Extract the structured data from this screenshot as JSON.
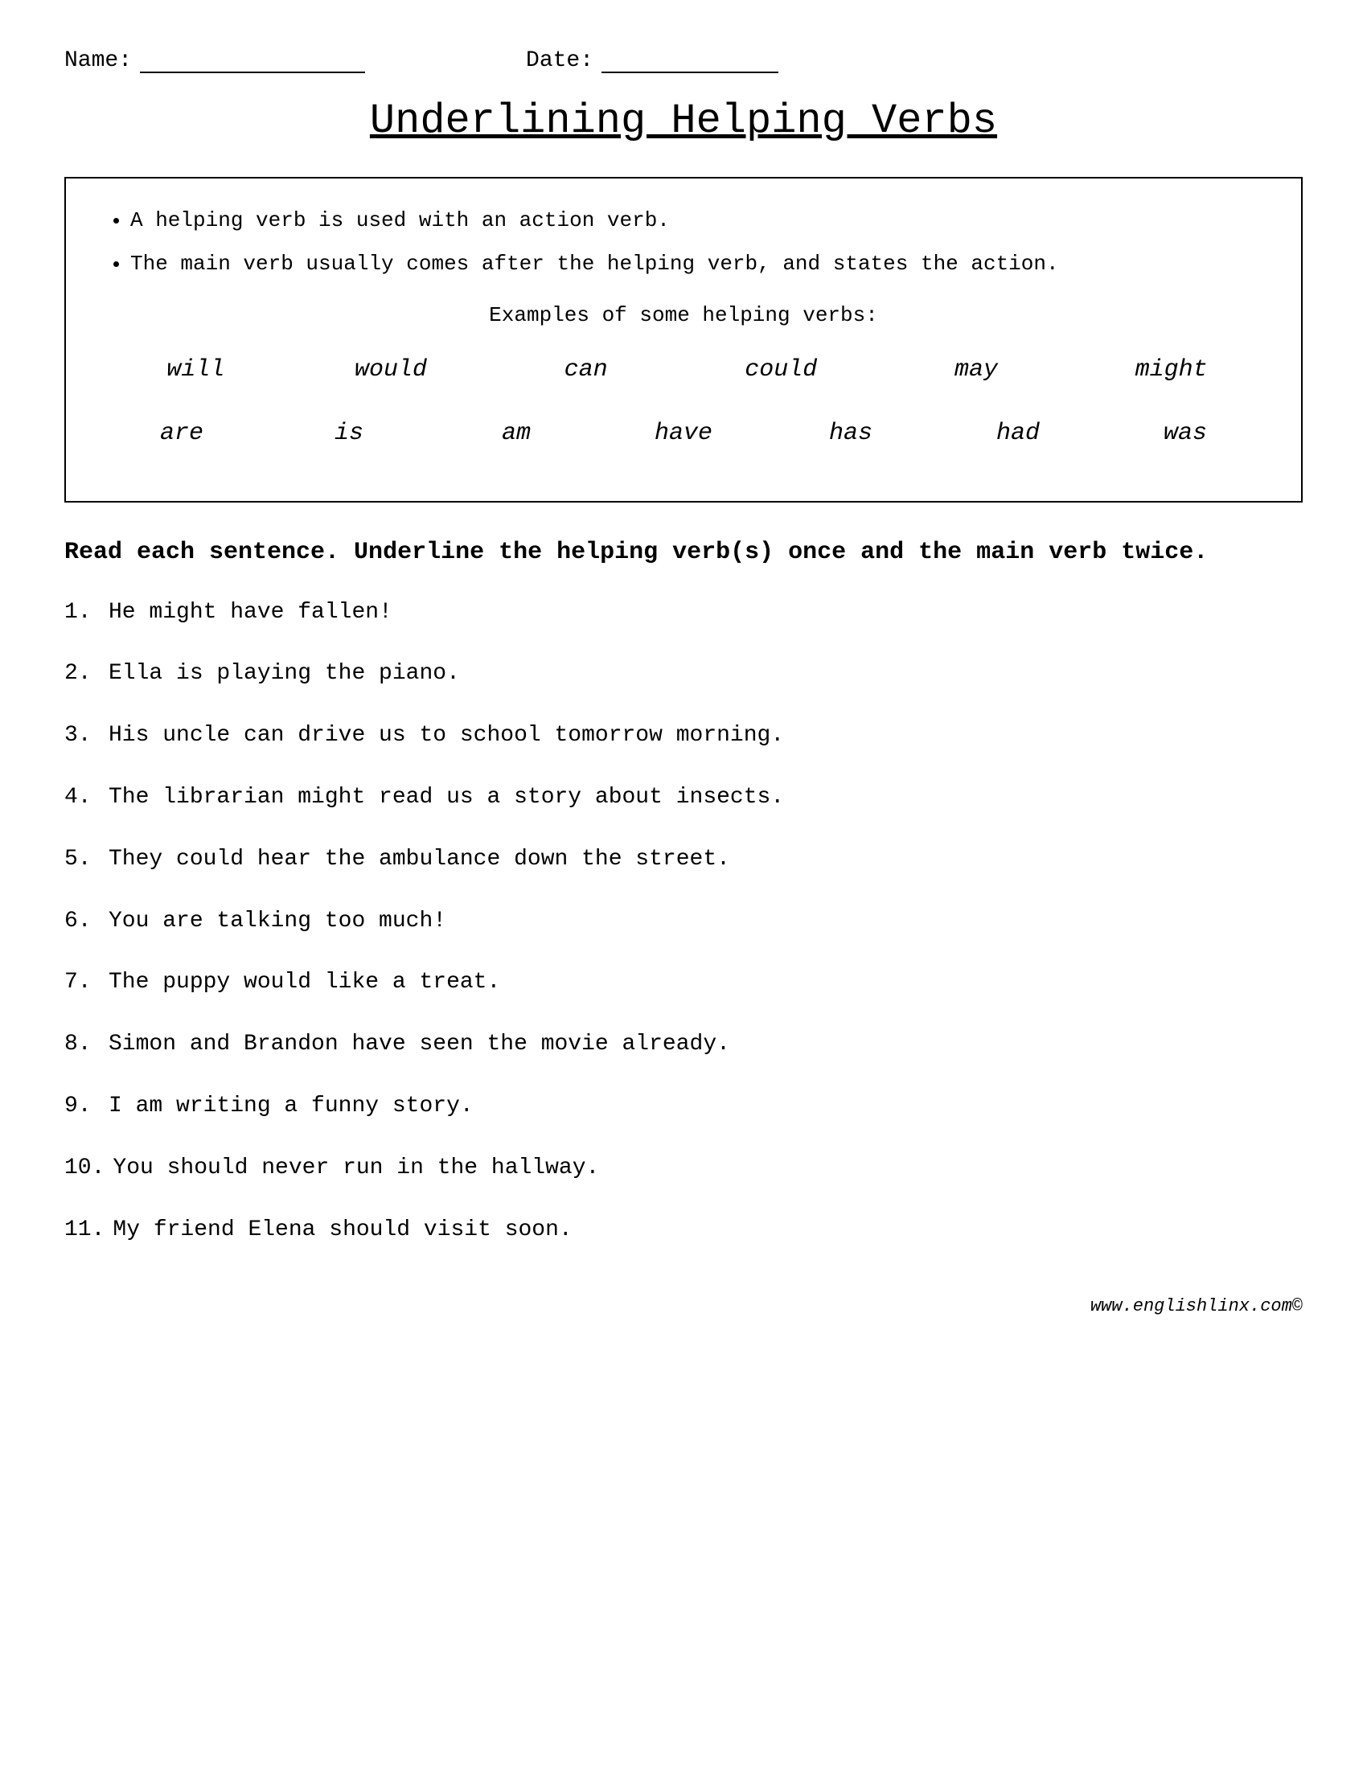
{
  "header": {
    "name_label": "Name:",
    "date_label": "Date:"
  },
  "title": "Underlining Helping Verbs",
  "info_box": {
    "bullets": [
      "A helping verb is used with an action verb.",
      "The main verb usually comes after the helping verb, and states the action."
    ],
    "examples_title": "Examples of some helping verbs:",
    "verb_row1": [
      "will",
      "would",
      "can",
      "could",
      "may",
      "might"
    ],
    "verb_row2": [
      "are",
      "is",
      "am",
      "have",
      "has",
      "had",
      "was"
    ]
  },
  "instructions": "Read each sentence. Underline the helping verb(s) once and the main verb twice.",
  "sentences": [
    {
      "number": "1.",
      "text": "He might have fallen!"
    },
    {
      "number": "2.",
      "text": "Ella is playing the piano."
    },
    {
      "number": "3.",
      "text": "His uncle can drive us to school tomorrow morning."
    },
    {
      "number": "4.",
      "text": "The librarian might read us a story about insects."
    },
    {
      "number": "5.",
      "text": "They could hear the ambulance down the street."
    },
    {
      "number": "6.",
      "text": "You are talking too much!"
    },
    {
      "number": "7.",
      "text": "The puppy would like a treat."
    },
    {
      "number": "8.",
      "text": "Simon and Brandon have seen the movie already."
    },
    {
      "number": "9.",
      "text": "I am writing a funny story."
    },
    {
      "number": "10.",
      "text": "You should never run in the hallway."
    },
    {
      "number": "11.",
      "text": "My friend Elena should visit soon."
    }
  ],
  "footer": "www.englishlinx.com©"
}
